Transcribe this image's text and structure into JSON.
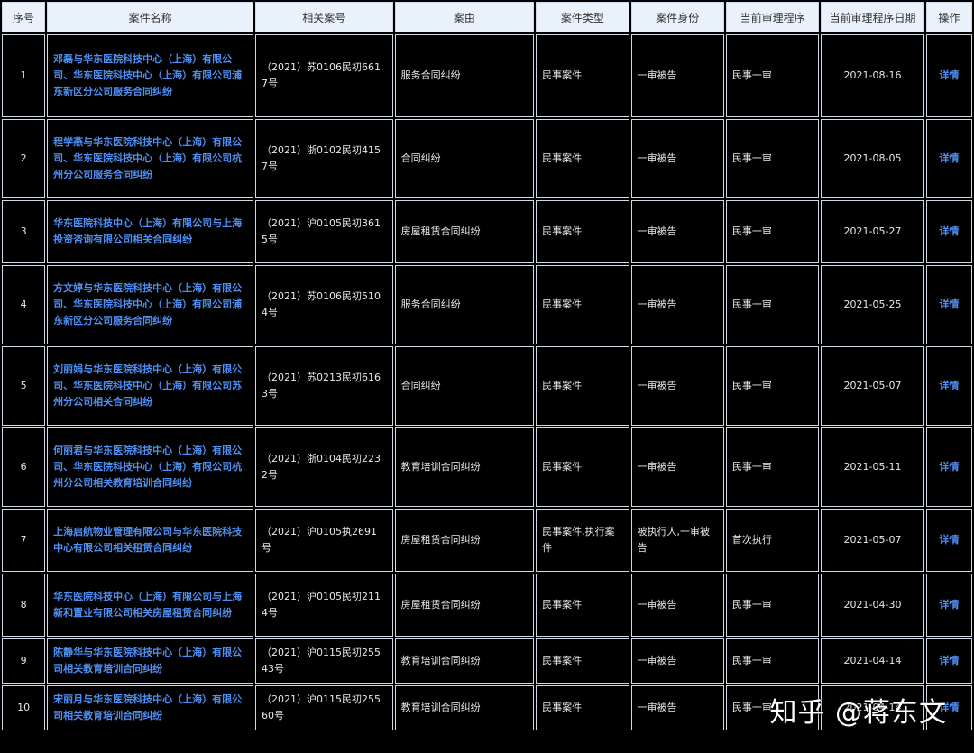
{
  "table": {
    "headers": [
      "序号",
      "案件名称",
      "相关案号",
      "案由",
      "案件类型",
      "案件身份",
      "当前审理程序",
      "当前审理程序日期",
      "操作"
    ],
    "rows": [
      {
        "no": "1",
        "name": "邓磊与华东医院科技中心（上海）有限公司、华东医院科技中心（上海）有限公司浦东新区分公司服务合同纠纷",
        "case_no": "（2021）苏0106民初6617号",
        "cause": "服务合同纠纷",
        "type": "民事案件",
        "role": "一审被告",
        "procedure": "民事一审",
        "date": "2021-08-16",
        "op": "详情"
      },
      {
        "no": "2",
        "name": "程学燕与华东医院科技中心（上海）有限公司、华东医院科技中心（上海）有限公司杭州分公司服务合同纠纷",
        "case_no": "（2021）浙0102民初4157号",
        "cause": "合同纠纷",
        "type": "民事案件",
        "role": "一审被告",
        "procedure": "民事一审",
        "date": "2021-08-05",
        "op": "详情"
      },
      {
        "no": "3",
        "name": "华东医院科技中心（上海）有限公司与上海投资咨询有限公司相关合同纠纷",
        "case_no": "（2021）沪0105民初3615号",
        "cause": "房屋租赁合同纠纷",
        "type": "民事案件",
        "role": "一审被告",
        "procedure": "民事一审",
        "date": "2021-05-27",
        "op": "详情"
      },
      {
        "no": "4",
        "name": "方文婷与华东医院科技中心（上海）有限公司、华东医院科技中心（上海）有限公司浦东新区分公司服务合同纠纷",
        "case_no": "（2021）苏0106民初5104号",
        "cause": "服务合同纠纷",
        "type": "民事案件",
        "role": "一审被告",
        "procedure": "民事一审",
        "date": "2021-05-25",
        "op": "详情"
      },
      {
        "no": "5",
        "name": "刘丽娟与华东医院科技中心（上海）有限公司、华东医院科技中心（上海）有限公司苏州分公司相关合同纠纷",
        "case_no": "（2021）苏0213民初6163号",
        "cause": "合同纠纷",
        "type": "民事案件",
        "role": "一审被告",
        "procedure": "民事一审",
        "date": "2021-05-07",
        "op": "详情"
      },
      {
        "no": "6",
        "name": "何丽君与华东医院科技中心（上海）有限公司、华东医院科技中心（上海）有限公司杭州分公司相关教育培训合同纠纷",
        "case_no": "（2021）浙0104民初2232号",
        "cause": "教育培训合同纠纷",
        "type": "民事案件",
        "role": "一审被告",
        "procedure": "民事一审",
        "date": "2021-05-11",
        "op": "详情"
      },
      {
        "no": "7",
        "name": "上海启航物业管理有限公司与华东医院科技中心有限公司相关租赁合同纠纷",
        "case_no": "（2021）沪0105执2691号",
        "cause": "房屋租赁合同纠纷",
        "type": "民事案件,执行案件",
        "role": "被执行人,一审被告",
        "procedure": "首次执行",
        "date": "2021-05-07",
        "op": "详情"
      },
      {
        "no": "8",
        "name": "华东医院科技中心（上海）有限公司与上海新和置业有限公司相关房屋租赁合同纠纷",
        "case_no": "（2021）沪0105民初2114号",
        "cause": "房屋租赁合同纠纷",
        "type": "民事案件",
        "role": "一审被告",
        "procedure": "民事一审",
        "date": "2021-04-30",
        "op": "详情"
      },
      {
        "no": "9",
        "name": "陈静华与华东医院科技中心（上海）有限公司相关教育培训合同纠纷",
        "case_no": "（2021）沪0115民初25543号",
        "cause": "教育培训合同纠纷",
        "type": "民事案件",
        "role": "一审被告",
        "procedure": "民事一审",
        "date": "2021-04-14",
        "op": "详情"
      },
      {
        "no": "10",
        "name": "宋丽月与华东医院科技中心（上海）有限公司相关教育培训合同纠纷",
        "case_no": "（2021）沪0115民初25560号",
        "cause": "教育培训合同纠纷",
        "type": "民事案件",
        "role": "一审被告",
        "procedure": "民事一审",
        "date": "2021-04-14",
        "op": "详情"
      }
    ]
  },
  "watermark": "知乎 @蒋东文",
  "colors": {
    "header_bg": "#e9f1fb",
    "link": "#4f8ff2",
    "cell_bg": "#000000",
    "border": "#cfd9e6"
  }
}
